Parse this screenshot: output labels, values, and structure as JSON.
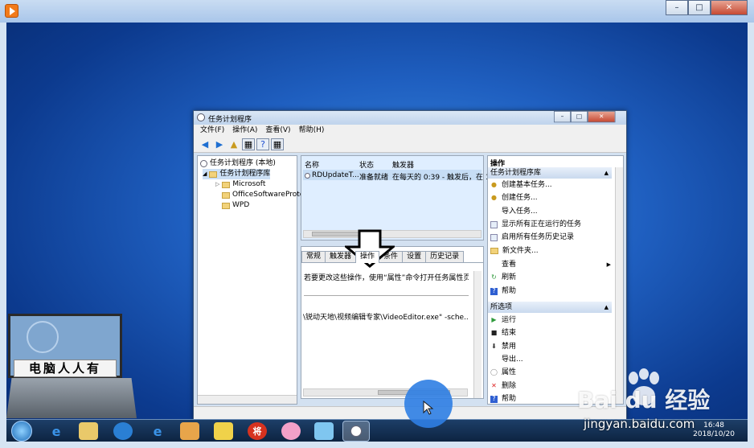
{
  "window": {
    "title": "任务计划程序"
  },
  "menu": [
    "文件(F)",
    "操作(A)",
    "查看(V)",
    "帮助(H)"
  ],
  "tree": {
    "root": "任务计划程序 (本地)",
    "library": "任务计划程序库",
    "children": [
      "Microsoft",
      "OfficeSoftwareProte",
      "WPD"
    ]
  },
  "task_list": {
    "columns": [
      "名称",
      "状态",
      "触发器"
    ],
    "rows": [
      [
        "RDUpdateT...",
        "准备就绪",
        "在每天的 0:39 - 触发后，在 1"
      ]
    ]
  },
  "tabs": [
    "常规",
    "触发器",
    "操作",
    "条件",
    "设置",
    "历史记录"
  ],
  "active_tab": "操作",
  "tab_content": {
    "info": "若要更改这些操作，使用“属性”命令打开任务属性页。",
    "action_path": "\\锐动天地\\视频编辑专家\\VideoEditor.exe\" -sche..."
  },
  "actions": {
    "header": "操作",
    "section1": "任务计划程序库",
    "items1": [
      "创建基本任务...",
      "创建任务...",
      "导入任务...",
      "显示所有正在运行的任务",
      "启用所有任务历史记录",
      "新文件夹...",
      "查看",
      "刷新",
      "帮助"
    ],
    "section2": "所选项",
    "items2": [
      "运行",
      "结束",
      "禁用",
      "导出...",
      "属性",
      "删除",
      "帮助"
    ]
  },
  "laptop_label": "电脑人人有",
  "clock": {
    "time": "16:48",
    "date": "2018/10/20"
  },
  "taskbar_icon_label": "将",
  "watermark": {
    "brand": "Bai du 经验",
    "url": "jingyan.baidu.com"
  },
  "colors": {
    "desktop": "#1f5fc0",
    "accent": "#2f7fe4"
  }
}
